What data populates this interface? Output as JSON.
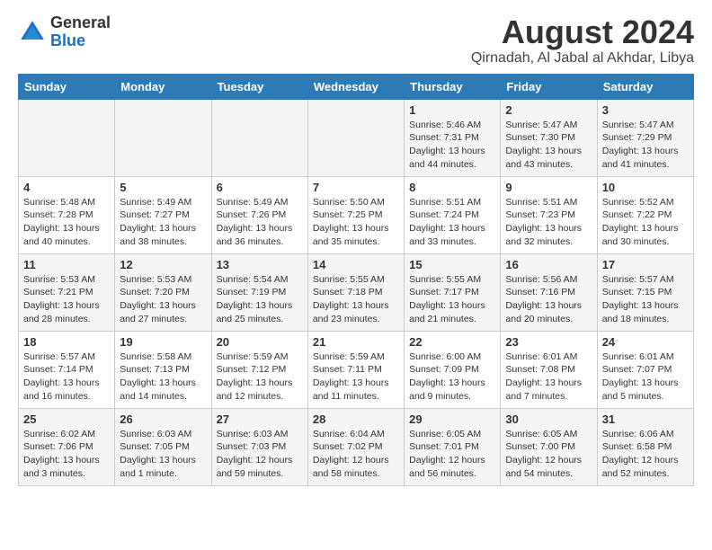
{
  "header": {
    "logo_line1": "General",
    "logo_line2": "Blue",
    "main_title": "August 2024",
    "subtitle": "Qirnadah, Al Jabal al Akhdar, Libya"
  },
  "days_of_week": [
    "Sunday",
    "Monday",
    "Tuesday",
    "Wednesday",
    "Thursday",
    "Friday",
    "Saturday"
  ],
  "weeks": [
    [
      {
        "day": "",
        "info": ""
      },
      {
        "day": "",
        "info": ""
      },
      {
        "day": "",
        "info": ""
      },
      {
        "day": "",
        "info": ""
      },
      {
        "day": "1",
        "info": "Sunrise: 5:46 AM\nSunset: 7:31 PM\nDaylight: 13 hours\nand 44 minutes."
      },
      {
        "day": "2",
        "info": "Sunrise: 5:47 AM\nSunset: 7:30 PM\nDaylight: 13 hours\nand 43 minutes."
      },
      {
        "day": "3",
        "info": "Sunrise: 5:47 AM\nSunset: 7:29 PM\nDaylight: 13 hours\nand 41 minutes."
      }
    ],
    [
      {
        "day": "4",
        "info": "Sunrise: 5:48 AM\nSunset: 7:28 PM\nDaylight: 13 hours\nand 40 minutes."
      },
      {
        "day": "5",
        "info": "Sunrise: 5:49 AM\nSunset: 7:27 PM\nDaylight: 13 hours\nand 38 minutes."
      },
      {
        "day": "6",
        "info": "Sunrise: 5:49 AM\nSunset: 7:26 PM\nDaylight: 13 hours\nand 36 minutes."
      },
      {
        "day": "7",
        "info": "Sunrise: 5:50 AM\nSunset: 7:25 PM\nDaylight: 13 hours\nand 35 minutes."
      },
      {
        "day": "8",
        "info": "Sunrise: 5:51 AM\nSunset: 7:24 PM\nDaylight: 13 hours\nand 33 minutes."
      },
      {
        "day": "9",
        "info": "Sunrise: 5:51 AM\nSunset: 7:23 PM\nDaylight: 13 hours\nand 32 minutes."
      },
      {
        "day": "10",
        "info": "Sunrise: 5:52 AM\nSunset: 7:22 PM\nDaylight: 13 hours\nand 30 minutes."
      }
    ],
    [
      {
        "day": "11",
        "info": "Sunrise: 5:53 AM\nSunset: 7:21 PM\nDaylight: 13 hours\nand 28 minutes."
      },
      {
        "day": "12",
        "info": "Sunrise: 5:53 AM\nSunset: 7:20 PM\nDaylight: 13 hours\nand 27 minutes."
      },
      {
        "day": "13",
        "info": "Sunrise: 5:54 AM\nSunset: 7:19 PM\nDaylight: 13 hours\nand 25 minutes."
      },
      {
        "day": "14",
        "info": "Sunrise: 5:55 AM\nSunset: 7:18 PM\nDaylight: 13 hours\nand 23 minutes."
      },
      {
        "day": "15",
        "info": "Sunrise: 5:55 AM\nSunset: 7:17 PM\nDaylight: 13 hours\nand 21 minutes."
      },
      {
        "day": "16",
        "info": "Sunrise: 5:56 AM\nSunset: 7:16 PM\nDaylight: 13 hours\nand 20 minutes."
      },
      {
        "day": "17",
        "info": "Sunrise: 5:57 AM\nSunset: 7:15 PM\nDaylight: 13 hours\nand 18 minutes."
      }
    ],
    [
      {
        "day": "18",
        "info": "Sunrise: 5:57 AM\nSunset: 7:14 PM\nDaylight: 13 hours\nand 16 minutes."
      },
      {
        "day": "19",
        "info": "Sunrise: 5:58 AM\nSunset: 7:13 PM\nDaylight: 13 hours\nand 14 minutes."
      },
      {
        "day": "20",
        "info": "Sunrise: 5:59 AM\nSunset: 7:12 PM\nDaylight: 13 hours\nand 12 minutes."
      },
      {
        "day": "21",
        "info": "Sunrise: 5:59 AM\nSunset: 7:11 PM\nDaylight: 13 hours\nand 11 minutes."
      },
      {
        "day": "22",
        "info": "Sunrise: 6:00 AM\nSunset: 7:09 PM\nDaylight: 13 hours\nand 9 minutes."
      },
      {
        "day": "23",
        "info": "Sunrise: 6:01 AM\nSunset: 7:08 PM\nDaylight: 13 hours\nand 7 minutes."
      },
      {
        "day": "24",
        "info": "Sunrise: 6:01 AM\nSunset: 7:07 PM\nDaylight: 13 hours\nand 5 minutes."
      }
    ],
    [
      {
        "day": "25",
        "info": "Sunrise: 6:02 AM\nSunset: 7:06 PM\nDaylight: 13 hours\nand 3 minutes."
      },
      {
        "day": "26",
        "info": "Sunrise: 6:03 AM\nSunset: 7:05 PM\nDaylight: 13 hours\nand 1 minute."
      },
      {
        "day": "27",
        "info": "Sunrise: 6:03 AM\nSunset: 7:03 PM\nDaylight: 12 hours\nand 59 minutes."
      },
      {
        "day": "28",
        "info": "Sunrise: 6:04 AM\nSunset: 7:02 PM\nDaylight: 12 hours\nand 58 minutes."
      },
      {
        "day": "29",
        "info": "Sunrise: 6:05 AM\nSunset: 7:01 PM\nDaylight: 12 hours\nand 56 minutes."
      },
      {
        "day": "30",
        "info": "Sunrise: 6:05 AM\nSunset: 7:00 PM\nDaylight: 12 hours\nand 54 minutes."
      },
      {
        "day": "31",
        "info": "Sunrise: 6:06 AM\nSunset: 6:58 PM\nDaylight: 12 hours\nand 52 minutes."
      }
    ]
  ]
}
